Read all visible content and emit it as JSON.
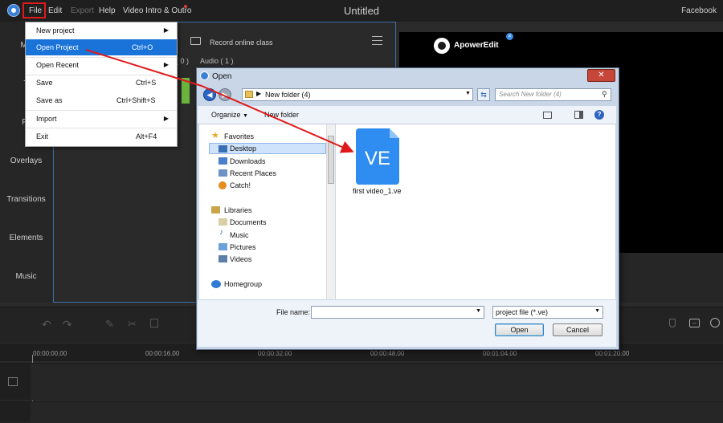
{
  "menubar": {
    "items": [
      {
        "label": "File"
      },
      {
        "label": "Edit"
      },
      {
        "label": "Export"
      },
      {
        "label": "Help"
      },
      {
        "label": "Video Intro & Outro"
      }
    ],
    "title": "Untitled",
    "right_label": "Facebook"
  },
  "sidebar": {
    "items": [
      {
        "label": "Me"
      },
      {
        "label": "T"
      },
      {
        "label": "Fil"
      },
      {
        "label": "Overlays"
      },
      {
        "label": "Transitions"
      },
      {
        "label": "Elements"
      },
      {
        "label": "Music"
      }
    ]
  },
  "media_panel": {
    "record_label": "Record online class",
    "count_label": "( 0 )",
    "audio_label": "Audio ( 1 )"
  },
  "preview": {
    "brand": "ApowerEdit"
  },
  "file_menu": {
    "items": [
      {
        "label": "New project",
        "shortcut": "",
        "submenu": true
      },
      {
        "label": "Open Project",
        "shortcut": "Ctrl+O",
        "submenu": false,
        "highlighted": true
      },
      {
        "label": "Open Recent",
        "shortcut": "",
        "submenu": true
      },
      {
        "label": "Save",
        "shortcut": "Ctrl+S",
        "submenu": false
      },
      {
        "label": "Save as",
        "shortcut": "Ctrl+Shift+S",
        "submenu": false
      },
      {
        "label": "Import",
        "shortcut": "",
        "submenu": true
      },
      {
        "label": "Exit",
        "shortcut": "Alt+F4",
        "submenu": false
      }
    ]
  },
  "timeline": {
    "ticks": [
      "00:00:00.00",
      "00:00:16.00",
      "00:00:32.00",
      "00:00:48.00",
      "00:01:04.00",
      "00:01:20.00"
    ]
  },
  "open_dialog": {
    "title": "Open",
    "close_label": "✕",
    "address": "New folder (4)",
    "search_placeholder": "Search New folder (4)",
    "organize_label": "Organize",
    "new_folder_label": "New folder",
    "favorites_header": "Favorites",
    "favorites": [
      "Desktop",
      "Downloads",
      "Recent Places",
      "Catch!"
    ],
    "libraries_header": "Libraries",
    "libraries": [
      "Documents",
      "Music",
      "Pictures",
      "Videos"
    ],
    "homegroup": "Homegroup",
    "file": {
      "icon_text": "VE",
      "name": "first video_1.ve"
    },
    "filename_label": "File name:",
    "filename_value": "",
    "filetype": "project file (*.ve)",
    "open_button": "Open",
    "cancel_button": "Cancel"
  },
  "colors": {
    "accent": "#1a73d9",
    "annotation": "#e01a1a",
    "ve_icon": "#2f8cf0"
  }
}
